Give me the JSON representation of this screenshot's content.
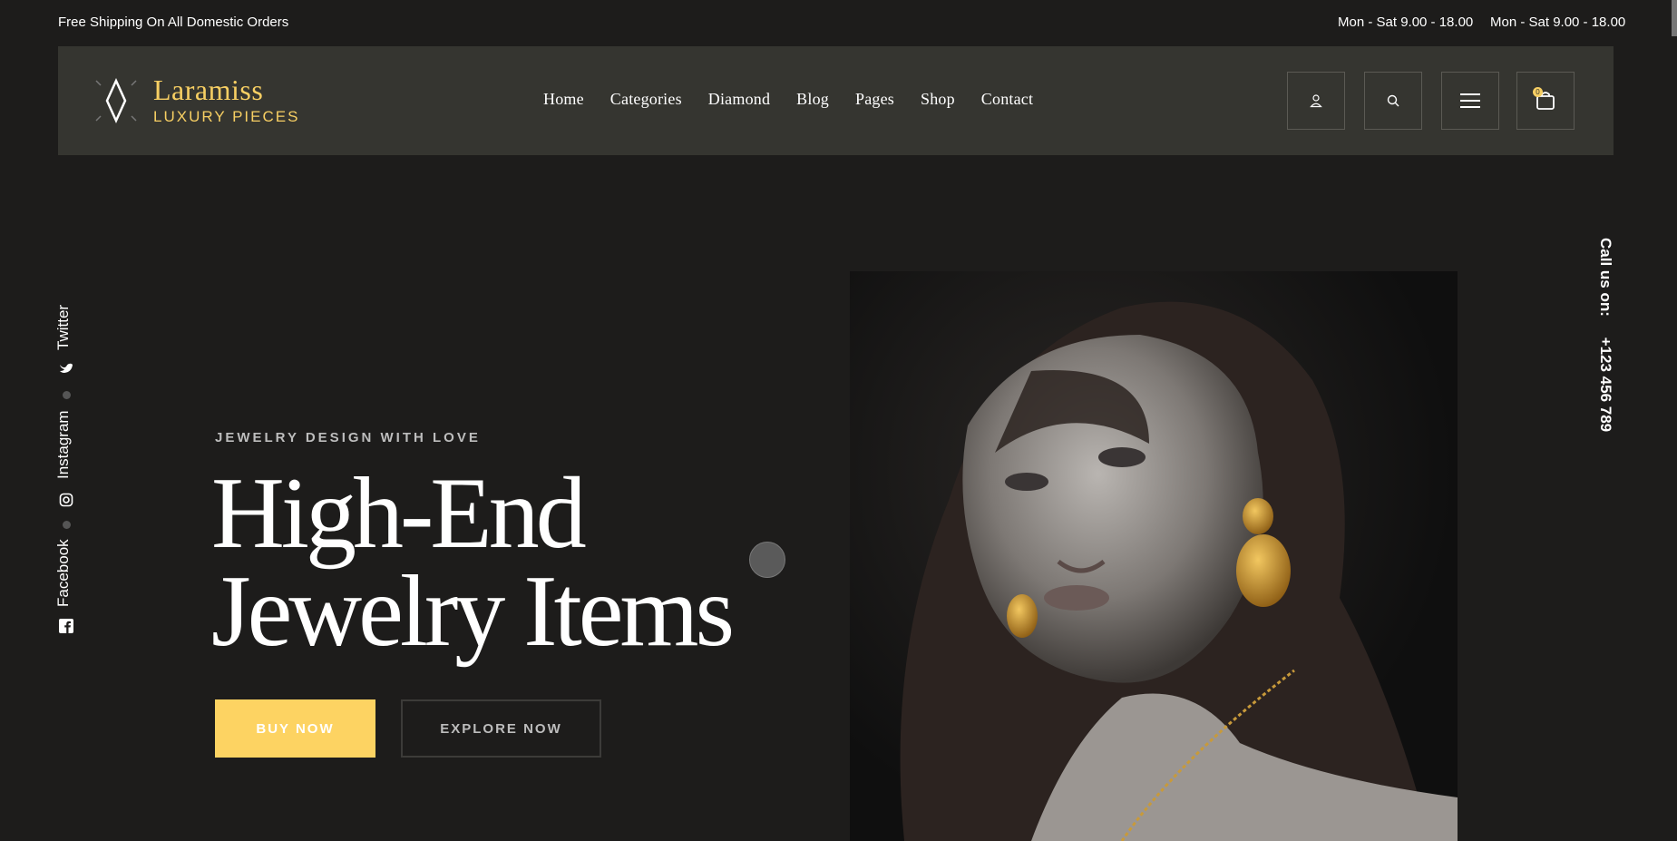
{
  "topbar": {
    "promo": "Free Shipping On All Domestic Orders",
    "hours_1": "Mon - Sat 9.00 - 18.00",
    "hours_2": "Mon - Sat 9.00 - 18.00"
  },
  "brand": {
    "title": "Laramiss",
    "subtitle": "LUXURY PIECES",
    "accent_color": "#f7cf63"
  },
  "nav": {
    "items": [
      "Home",
      "Categories",
      "Diamond",
      "Blog",
      "Pages",
      "Shop",
      "Contact"
    ]
  },
  "header_icons": {
    "account": "user-icon",
    "search": "search-icon",
    "menu": "hamburger-icon",
    "cart": "bag-icon",
    "cart_count": "0"
  },
  "social": {
    "items": [
      {
        "label": "Twitter",
        "icon": "twitter-icon"
      },
      {
        "label": "Instagram",
        "icon": "instagram-icon"
      },
      {
        "label": "Facebook",
        "icon": "facebook-icon"
      }
    ]
  },
  "contact": {
    "label": "Call us on:",
    "phone": "+123 456 789"
  },
  "hero": {
    "eyebrow": "JEWELRY DESIGN WITH LOVE",
    "headline_line1": "High-End",
    "headline_line2": "Jewelry Items",
    "buy_label": "BUY NOW",
    "explore_label": "EXPLORE NOW",
    "buy_color": "#fdd362"
  }
}
